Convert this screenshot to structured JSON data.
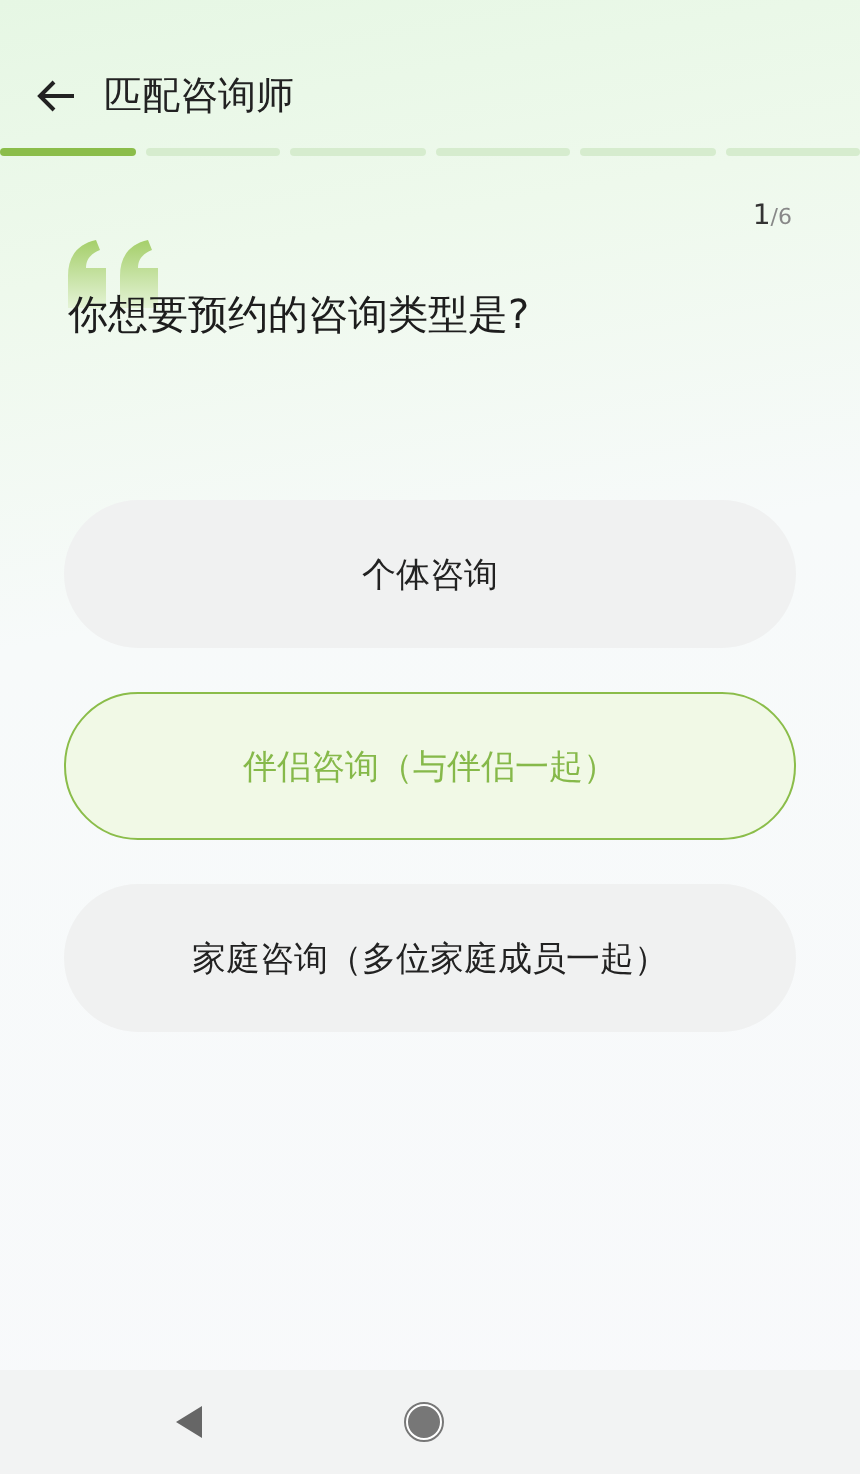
{
  "header": {
    "title": "匹配咨询师"
  },
  "progress": [
    {
      "done": true
    },
    {
      "done": false
    },
    {
      "done": false
    },
    {
      "done": false
    },
    {
      "done": false
    },
    {
      "done": false
    }
  ],
  "counter": {
    "current": "1",
    "total": "/6"
  },
  "question": "你想要预约的咨询类型是?",
  "options": [
    {
      "label": "个体咨询",
      "selected": false
    },
    {
      "label": "伴侣咨询（与伴侣一起）",
      "selected": true
    },
    {
      "label": "家庭咨询（多位家庭成员一起）",
      "selected": false
    }
  ]
}
